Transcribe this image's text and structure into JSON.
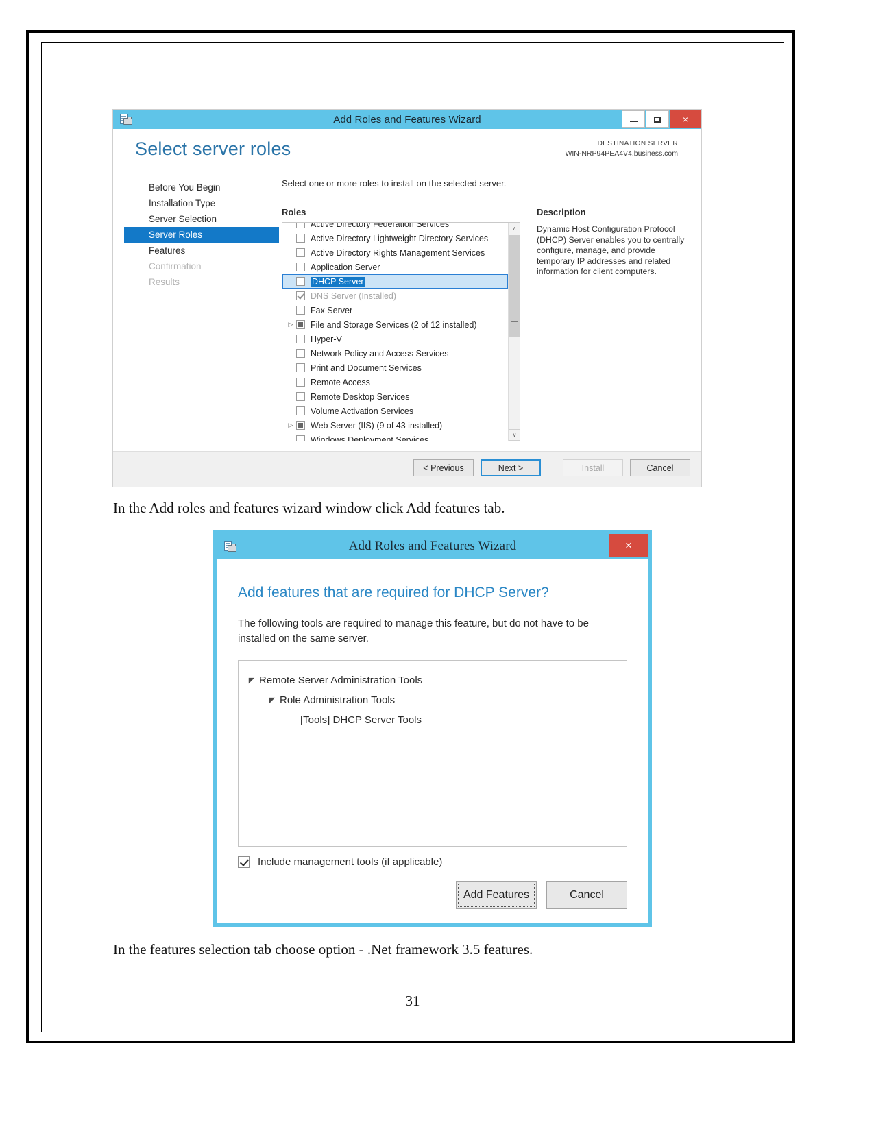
{
  "page": {
    "number": "31"
  },
  "captions": {
    "first": "In the Add roles and features wizard window click Add features tab.",
    "second": "In the features selection tab choose option - .Net framework 3.5 features."
  },
  "wizard_roles": {
    "title": "Add Roles and Features Wizard",
    "window_buttons": {
      "minimize": "minimize-icon",
      "maximize": "maximize-icon",
      "close": "×"
    },
    "heading": "Select server roles",
    "destination": {
      "label": "DESTINATION SERVER",
      "value": "WIN-NRP94PEA4V4.business.com"
    },
    "nav_items": [
      {
        "label": "Before You Begin",
        "state": "normal"
      },
      {
        "label": "Installation Type",
        "state": "normal"
      },
      {
        "label": "Server Selection",
        "state": "normal"
      },
      {
        "label": "Server Roles",
        "state": "selected"
      },
      {
        "label": "Features",
        "state": "normal"
      },
      {
        "label": "Confirmation",
        "state": "disabled"
      },
      {
        "label": "Results",
        "state": "disabled"
      }
    ],
    "prompt": "Select one or more roles to install on the selected server.",
    "roles_header": "Roles",
    "roles": [
      {
        "label": "Active Directory Federation Services",
        "checkbox": "unchecked",
        "expander": false,
        "state": "clipped"
      },
      {
        "label": "Active Directory Lightweight Directory Services",
        "checkbox": "unchecked",
        "expander": false,
        "state": "normal"
      },
      {
        "label": "Active Directory Rights Management Services",
        "checkbox": "unchecked",
        "expander": false,
        "state": "normal"
      },
      {
        "label": "Application Server",
        "checkbox": "unchecked",
        "expander": false,
        "state": "normal"
      },
      {
        "label": "DHCP Server",
        "checkbox": "unchecked",
        "expander": false,
        "state": "selected"
      },
      {
        "label": "DNS Server (Installed)",
        "checkbox": "checked",
        "expander": false,
        "state": "installed"
      },
      {
        "label": "Fax Server",
        "checkbox": "unchecked",
        "expander": false,
        "state": "normal"
      },
      {
        "label": "File and Storage Services (2 of 12 installed)",
        "checkbox": "partial",
        "expander": true,
        "state": "normal"
      },
      {
        "label": "Hyper-V",
        "checkbox": "unchecked",
        "expander": false,
        "state": "normal"
      },
      {
        "label": "Network Policy and Access Services",
        "checkbox": "unchecked",
        "expander": false,
        "state": "normal"
      },
      {
        "label": "Print and Document Services",
        "checkbox": "unchecked",
        "expander": false,
        "state": "normal"
      },
      {
        "label": "Remote Access",
        "checkbox": "unchecked",
        "expander": false,
        "state": "normal"
      },
      {
        "label": "Remote Desktop Services",
        "checkbox": "unchecked",
        "expander": false,
        "state": "normal"
      },
      {
        "label": "Volume Activation Services",
        "checkbox": "unchecked",
        "expander": false,
        "state": "normal"
      },
      {
        "label": "Web Server (IIS) (9 of 43 installed)",
        "checkbox": "partial",
        "expander": true,
        "state": "normal"
      },
      {
        "label": "Windows Deployment Services",
        "checkbox": "unchecked",
        "expander": false,
        "state": "clipped"
      }
    ],
    "description_header": "Description",
    "description_body": "Dynamic Host Configuration Protocol (DHCP) Server enables you to centrally configure, manage, and provide temporary IP addresses and related information for client computers.",
    "buttons": {
      "previous": "< Previous",
      "next": "Next >",
      "install": "Install",
      "cancel": "Cancel"
    },
    "scrollbar": {
      "up": "∧",
      "down": "∨"
    }
  },
  "wizard_addfeatures": {
    "title": "Add Roles and Features Wizard",
    "close_label": "×",
    "heading": "Add features that are required for DHCP Server?",
    "body_text": "The following tools are required to manage this feature, but do not have to be installed on the same server.",
    "tree": [
      {
        "label": "Remote Server Administration Tools",
        "level": 1,
        "expanded": true
      },
      {
        "label": "Role Administration Tools",
        "level": 2,
        "expanded": true
      },
      {
        "label": "[Tools] DHCP Server Tools",
        "level": 3,
        "expanded": false
      }
    ],
    "include_tools_label": "Include management tools (if applicable)",
    "include_tools_checked": true,
    "buttons": {
      "add_features": "Add Features",
      "cancel": "Cancel"
    }
  },
  "colors": {
    "titlebar": "#5fc4e8",
    "accent_blue": "#2a74a8",
    "selection": "#1379c8",
    "close_red": "#d64b3f"
  }
}
